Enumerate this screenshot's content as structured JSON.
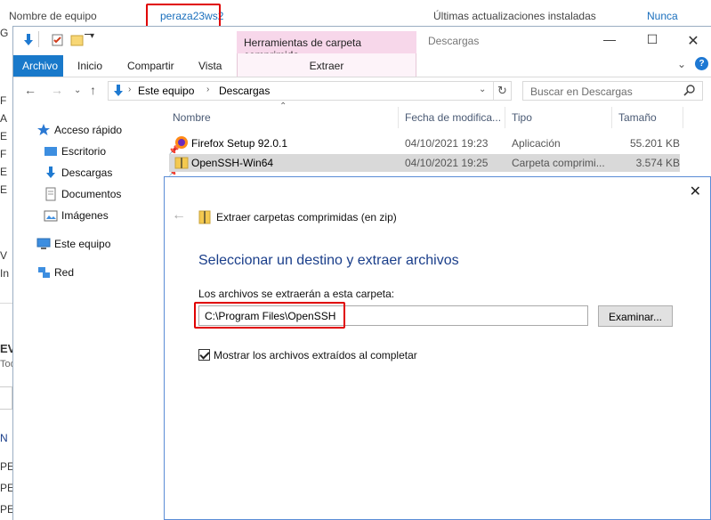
{
  "background": {
    "computer_name_label": "Nombre de equipo",
    "computer_name_value": "peraza23ws2",
    "updates_label": "Últimas actualizaciones instaladas",
    "updates_value": "Nunca",
    "left_edge_letters": [
      "G",
      "F",
      "A",
      "E",
      "F",
      "E",
      "E",
      "V",
      "In"
    ],
    "left_bottom": [
      "EV",
      "Tod",
      "N",
      "PE",
      "PE",
      "PE"
    ]
  },
  "explorer": {
    "context_header": "Herramientas de carpeta comprimida",
    "window_title": "Descargas",
    "tabs": [
      "Archivo",
      "Inicio",
      "Compartir",
      "Vista"
    ],
    "context_tab": "Extraer",
    "breadcrumb": [
      "Este equipo",
      "Descargas"
    ],
    "search_placeholder": "Buscar en Descargas",
    "nav": {
      "quick_access": "Acceso rápido",
      "items": [
        "Escritorio",
        "Descargas",
        "Documentos",
        "Imágenes"
      ],
      "this_pc": "Este equipo",
      "network": "Red"
    },
    "columns": [
      "Nombre",
      "Fecha de modifica...",
      "Tipo",
      "Tamaño"
    ],
    "files": [
      {
        "name": "Firefox Setup 92.0.1",
        "date": "04/10/2021 19:23",
        "type": "Aplicación",
        "size": "55.201 KB"
      },
      {
        "name": "OpenSSH-Win64",
        "date": "04/10/2021 19:25",
        "type": "Carpeta comprimi...",
        "size": "3.574 KB"
      }
    ]
  },
  "dialog": {
    "crumb": "Extraer carpetas comprimidas (en zip)",
    "heading": "Seleccionar un destino y extraer archivos",
    "label": "Los archivos se extraerán a esta carpeta:",
    "path_value": "C:\\Program Files\\OpenSSH",
    "browse_label": "Examinar...",
    "show_files_label": "Mostrar los archivos extraídos al completar",
    "show_files_checked": true
  },
  "colors": {
    "accent_blue": "#1979ca",
    "highlight_red": "#e00000",
    "context_pink": "#f7d7ea",
    "heading_blue": "#1a3e8a"
  }
}
